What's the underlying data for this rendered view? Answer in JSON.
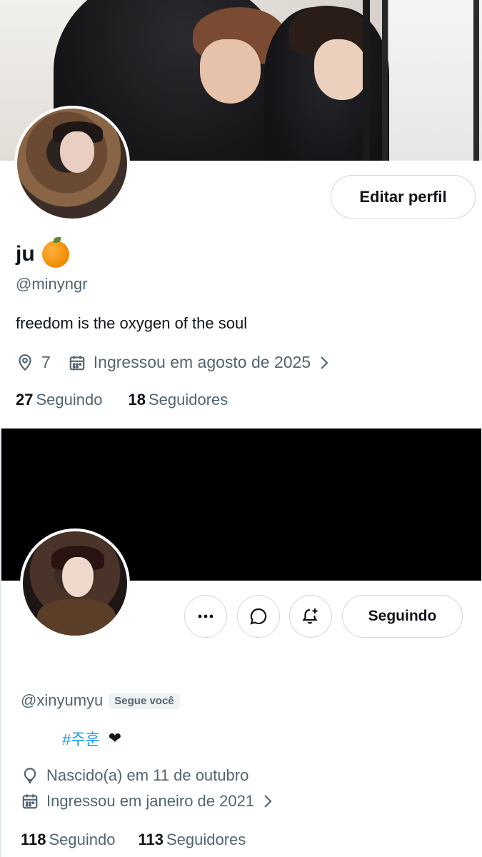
{
  "profile1": {
    "name": "ju",
    "name_emoji_icon": "orange-emoji",
    "handle": "@minyngr",
    "edit_button": "Editar perfil",
    "bio": "freedom is the oxygen of the soul",
    "location": "7",
    "joined": "Ingressou em agosto de 2025",
    "following_count": "27",
    "following_label": "Seguindo",
    "followers_count": "18",
    "followers_label": "Seguidores"
  },
  "profile2": {
    "handle": "@xinyumyu",
    "follows_you_badge": "Segue você",
    "bio_hashtag": "#주훈",
    "bio_heart": "❤",
    "birthday": "Nascido(a) em 11 de outubro",
    "joined": "Ingressou em janeiro de 2021",
    "following_button": "Seguindo",
    "following_count": "118",
    "following_label": "Seguindo",
    "followers_count": "113",
    "followers_label": "Seguidores"
  },
  "colors": {
    "text": "#0f1419",
    "secondary": "#536471",
    "link": "#1d9bf0",
    "border": "#cfd9de"
  }
}
